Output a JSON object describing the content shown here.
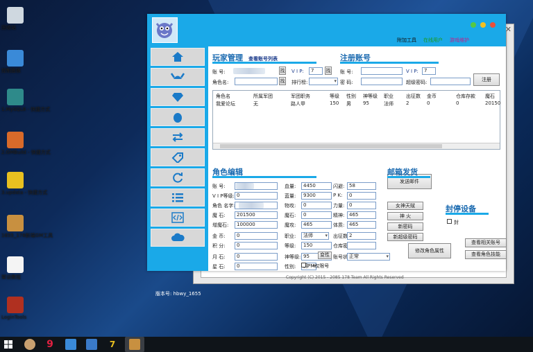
{
  "desktop": {
    "icons": [
      {
        "label": "回收站",
        "icon": "recycle-bin-icon",
        "color": "#cfd8e0"
      },
      {
        "label": "控制面板",
        "icon": "control-panel-icon",
        "color": "#3a8ad8"
      },
      {
        "label": "1.MySQL8 - 快捷方式",
        "icon": "mysql-icon",
        "color": "#2e8a8a"
      },
      {
        "label": "2.GMBuild - 快捷方式",
        "icon": "gmbuild-icon",
        "color": "#d86a2a"
      },
      {
        "label": "3.updata - 快捷方式",
        "icon": "updata-icon",
        "color": "#e8c020"
      },
      {
        "label": "1655_178新端GM工具",
        "icon": "gm-tool-icon",
        "color": "#c89040"
      },
      {
        "label": "架设教程",
        "icon": "document-icon",
        "color": "#f4f4f4"
      },
      {
        "label": "LoginTools",
        "icon": "login-tools-icon",
        "color": "#b03020"
      }
    ]
  },
  "window": {
    "top_links": {
      "tools": "附加工具",
      "online": "在线用户",
      "maintain": "游戏维护"
    },
    "version": "版本号: hbwy_1655",
    "player_mgmt": {
      "title": "玩家管理",
      "view_list": "查看账号列表",
      "account_label": "账 号:",
      "find": "找",
      "vip_label": "V I P:",
      "vip_value": "7",
      "vip_find": "找",
      "role_label": "角色名:",
      "role_find": "找",
      "rank_label": "排行榜:"
    },
    "register": {
      "title": "注册账号",
      "account_label": "账 号:",
      "vip_label": "V I P:",
      "vip_value": "7",
      "password_label": "密 码:",
      "super_pw_label": "超级密码:",
      "register_btn": "注册"
    },
    "grid": {
      "headers": [
        "角色名",
        "所属军团",
        "军团职务",
        "等级",
        "性别",
        "神等级",
        "职业",
        "出征数",
        "金币",
        "仓库存款",
        "魔石"
      ],
      "rows": [
        [
          "我爱论坛",
          "无",
          "路人甲",
          "150",
          "男",
          "95",
          "法师",
          "2",
          "0",
          "0",
          "20150"
        ]
      ]
    },
    "role_edit": {
      "title": "角色编辑",
      "fields_left": [
        {
          "label": "账 号:",
          "value": ""
        },
        {
          "label": "V I P等级:",
          "value": "0"
        },
        {
          "label": "角色 名字:",
          "value": ""
        },
        {
          "label": "魔 石:",
          "value": "201500"
        },
        {
          "label": "增魔石:",
          "value": "100000"
        },
        {
          "label": "金 币:",
          "value": "0"
        },
        {
          "label": "积 分:",
          "value": "0"
        },
        {
          "label": "月 石:",
          "value": "0"
        },
        {
          "label": "星 石:",
          "value": "0"
        }
      ],
      "fields_mid": [
        {
          "label": "血量:",
          "value": "4450"
        },
        {
          "label": "蓝量:",
          "value": "9300"
        },
        {
          "label": "物攻:",
          "value": "0"
        },
        {
          "label": "魔石:",
          "value": "0"
        },
        {
          "label": "魔攻:",
          "value": "465"
        },
        {
          "label": "职业:",
          "value": "法师"
        },
        {
          "label": "等级:",
          "value": "150"
        },
        {
          "label": "神等级:",
          "value": "95"
        },
        {
          "label": "性别:",
          "value": "男"
        }
      ],
      "fields_right": [
        {
          "label": "闪避:",
          "value": "58"
        },
        {
          "label": "P K:",
          "value": "0"
        },
        {
          "label": "力量:",
          "value": "0"
        },
        {
          "label": "精神:",
          "value": "465"
        },
        {
          "label": "体质:",
          "value": "465"
        },
        {
          "label": "出征数:",
          "value": "2"
        },
        {
          "label": "仓库密码:",
          "value": ""
        },
        {
          "label": "账号状态:",
          "value": "正常"
        }
      ],
      "transfer": "变性",
      "pm": "PM权限号",
      "modify": "修改角色属性",
      "btns": {
        "god": "女神天赋",
        "divine": "神 火",
        "new_pw": "新密码",
        "new_super": "新超级密码"
      }
    },
    "mail": {
      "title": "邮箱发货",
      "send": "发送邮件"
    },
    "ban": {
      "title": "封停设备",
      "ban_label": "封",
      "related": "查看相关账号",
      "skills": "查看角色技能"
    },
    "copyright": "Copyright (C) 2015 - 2085 178 Team All Rights Reserved"
  }
}
